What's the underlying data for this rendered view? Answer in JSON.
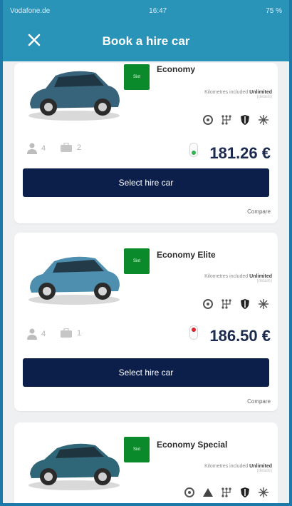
{
  "statusbar": {
    "carrier": "Vodafone.de",
    "time": "16:47",
    "battery": "75 %"
  },
  "header": {
    "title": "Book a hire car"
  },
  "cards": [
    {
      "name": "Economy",
      "badge": "Sixt",
      "mileage_label": "Kilometres included",
      "mileage_value": "Unlimited",
      "mileage_sub": "(details)",
      "passengers": "4",
      "luggage": "2",
      "price": "181.26 €",
      "level_color": "#2db34a",
      "button_label": "Select hire car",
      "compare_label": "Compare"
    },
    {
      "name": "Economy Elite",
      "badge": "Sixt",
      "mileage_label": "Kilometres included",
      "mileage_value": "Unlimited",
      "mileage_sub": "(details)",
      "passengers": "4",
      "luggage": "1",
      "price": "186.50 €",
      "level_color": "#e0202a",
      "button_label": "Select hire car",
      "compare_label": "Compare"
    },
    {
      "name": "Economy Special",
      "badge": "Sixt",
      "mileage_label": "Kilometres included",
      "mileage_value": "Unlimited",
      "mileage_sub": "(details)"
    }
  ],
  "colors": {
    "header": "#2a93b8",
    "button": "#0b1f4a",
    "badge": "#0a8a2a",
    "price": "#1d2a4f"
  },
  "icons": [
    "gps-icon",
    "manual-gearbox-icon",
    "safety-icon",
    "air-conditioning-icon"
  ]
}
